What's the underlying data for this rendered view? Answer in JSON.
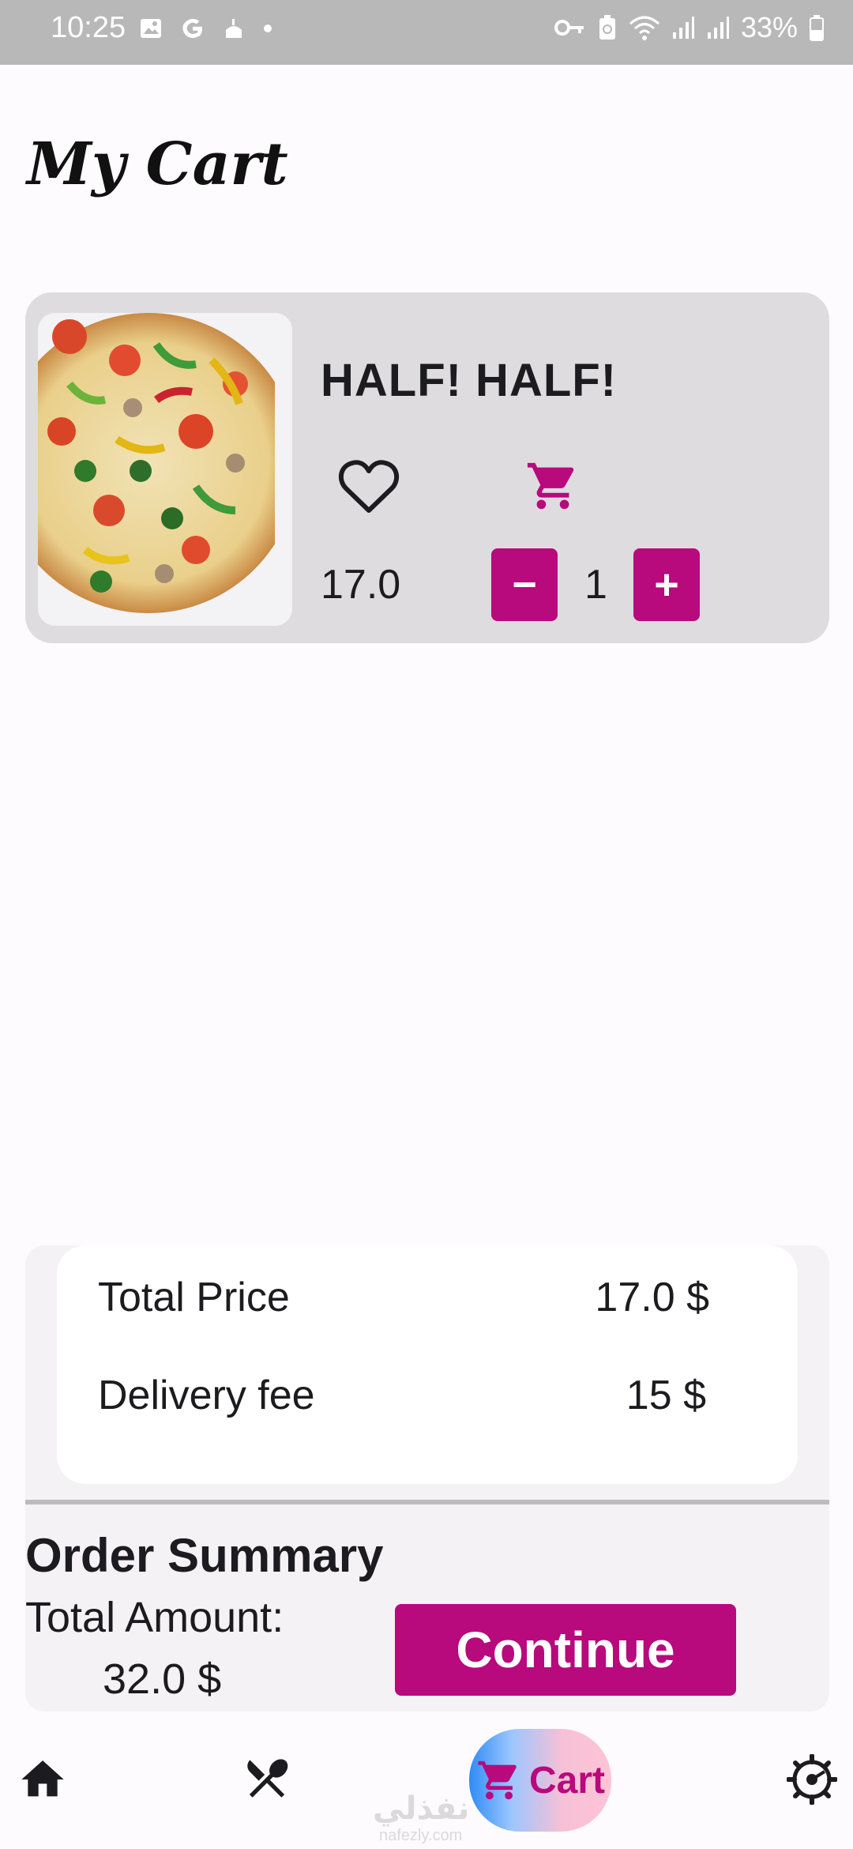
{
  "status_bar": {
    "time": "10:25",
    "battery": "33%",
    "left_icons": [
      "image-icon",
      "google-icon",
      "mosque-icon",
      "dot-icon"
    ],
    "right_icons": [
      "key-icon",
      "battery-saver-icon",
      "wifi-icon",
      "signal-icon",
      "signal-icon",
      "battery-icon"
    ]
  },
  "page": {
    "title": "My Cart"
  },
  "cart_items": [
    {
      "name": "HALF! HALF!",
      "price": "17.0",
      "quantity": "1",
      "minus_label": "−",
      "plus_label": "+",
      "image": "pizza-image",
      "icons": [
        "heart-outline-icon",
        "cart-icon"
      ]
    }
  ],
  "summary": {
    "total_price_label": "Total Price",
    "total_price_value": "17.0 $",
    "delivery_fee_label": "Delivery fee",
    "delivery_fee_value": "15 $",
    "order_summary_title": "Order Summary",
    "total_amount_label": "Total Amount:",
    "total_amount_value": "32.0 $",
    "continue_label": "Continue"
  },
  "bottom_nav": {
    "items": [
      {
        "name": "home",
        "icon": "home-icon"
      },
      {
        "name": "menu",
        "icon": "fork-knife-icon"
      },
      {
        "name": "cart",
        "icon": "cart-icon",
        "label": "Cart",
        "active": true
      },
      {
        "name": "settings",
        "icon": "gear-icon"
      }
    ]
  },
  "watermark": {
    "arabic": "نفذلي",
    "latin": "nafezly.com"
  },
  "colors": {
    "accent": "#b8097d",
    "card": "#dedcdf",
    "status_bar": "#b8b8b8"
  }
}
